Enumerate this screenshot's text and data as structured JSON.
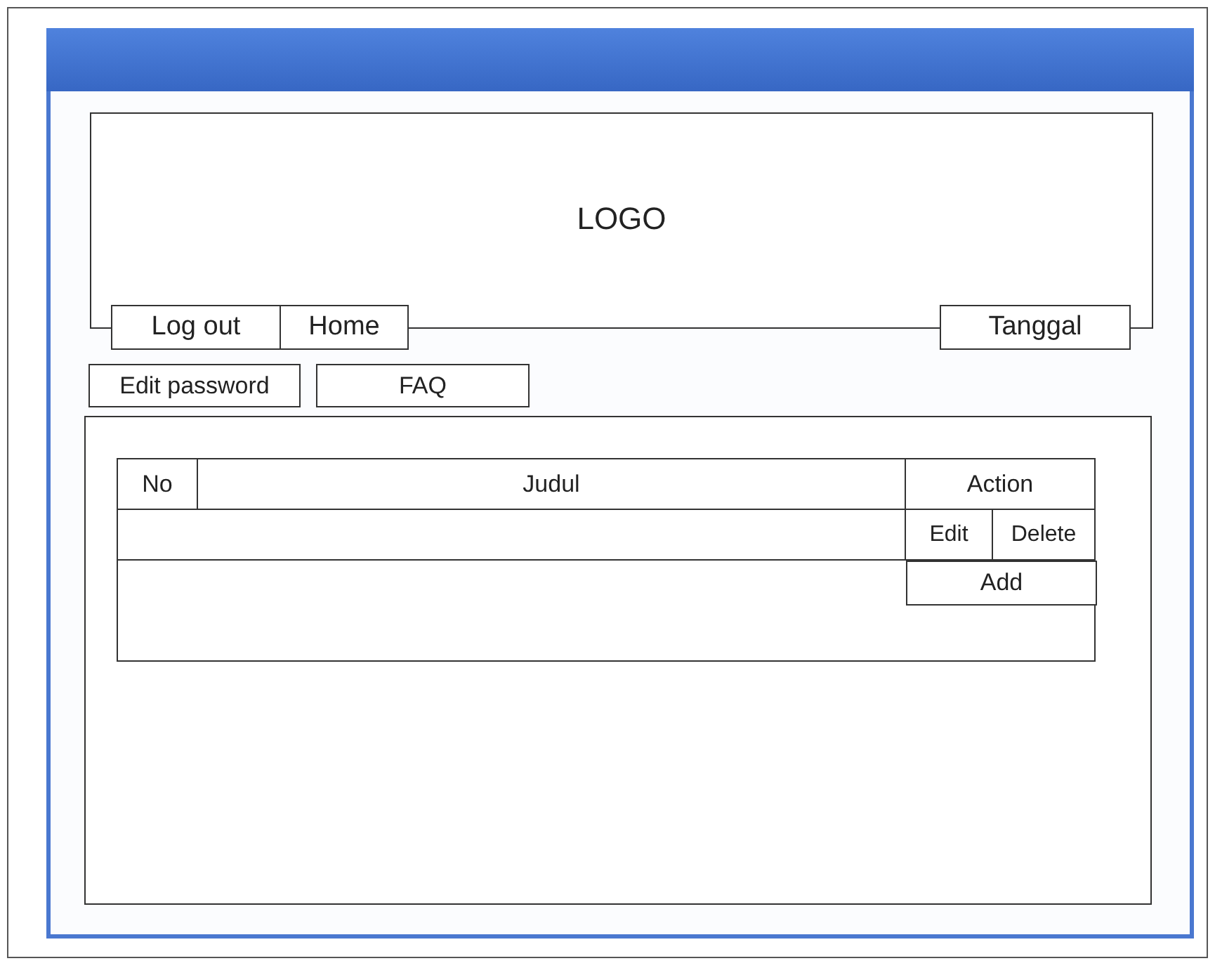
{
  "logo": "LOGO",
  "nav": [
    {
      "label": "Log out"
    },
    {
      "label": "Home"
    }
  ],
  "date": "Tanggal",
  "links": [
    "Edit password",
    "FAQ"
  ],
  "table": {
    "columns": [
      "No",
      "Judul",
      "Action"
    ],
    "row_actions": [
      "Edit",
      "Delete"
    ],
    "add": "Add"
  }
}
